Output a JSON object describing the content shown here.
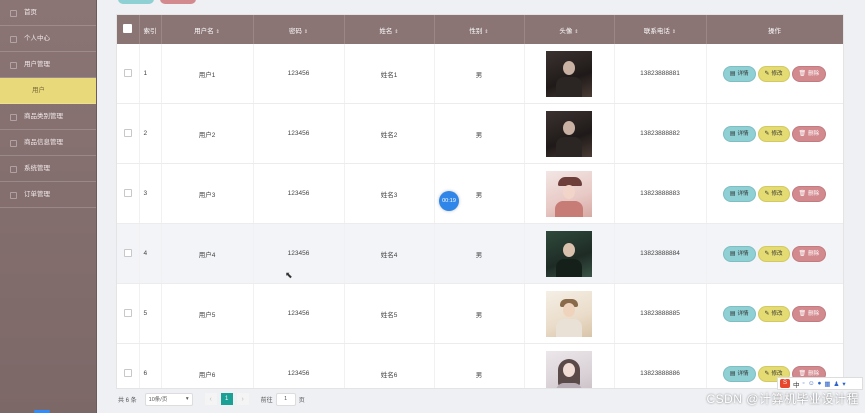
{
  "sidebar": {
    "items": [
      {
        "label": "首页"
      },
      {
        "label": "个人中心"
      },
      {
        "label": "用户管理"
      },
      {
        "label": "用户"
      },
      {
        "label": "商品类别管理"
      },
      {
        "label": "商品信息管理"
      },
      {
        "label": "系统管理"
      },
      {
        "label": "订单管理"
      }
    ]
  },
  "table": {
    "headers": {
      "index": "索引",
      "username": "用户名",
      "password": "密码",
      "name": "姓名",
      "gender": "性别",
      "avatar": "头像",
      "phone": "联系电话",
      "actions": "操作"
    },
    "rows": [
      {
        "index": "1",
        "username": "用户1",
        "password": "123456",
        "name": "姓名1",
        "gender": "男",
        "phone": "13823888881",
        "avatar_style": "dark"
      },
      {
        "index": "2",
        "username": "用户2",
        "password": "123456",
        "name": "姓名2",
        "gender": "男",
        "phone": "13823888882",
        "avatar_style": "dark"
      },
      {
        "index": "3",
        "username": "用户3",
        "password": "123456",
        "name": "姓名3",
        "gender": "男",
        "phone": "13823888883",
        "avatar_style": "pink"
      },
      {
        "index": "4",
        "username": "用户4",
        "password": "123456",
        "name": "姓名4",
        "gender": "男",
        "phone": "13823888884",
        "avatar_style": "green"
      },
      {
        "index": "5",
        "username": "用户5",
        "password": "123456",
        "name": "姓名5",
        "gender": "男",
        "phone": "13823888885",
        "avatar_style": "light"
      },
      {
        "index": "6",
        "username": "用户6",
        "password": "123456",
        "name": "姓名6",
        "gender": "男",
        "phone": "13823888886",
        "avatar_style": "gray"
      }
    ],
    "action_labels": {
      "detail": "详情",
      "edit": "修改",
      "delete": "删除"
    }
  },
  "pagination": {
    "total": "共 6 条",
    "page_size": "10条/页",
    "current": "1",
    "goto_prefix": "前往",
    "goto_value": "1",
    "goto_suffix": "页"
  },
  "overlay": {
    "timer": "00:19",
    "watermark": "CSDN @计算机毕业设计程"
  },
  "ime": {
    "badge": "S",
    "lang": "中"
  },
  "colors": {
    "sidebar": "#8a7474",
    "active_item": "#e8d97a",
    "table_header": "#8a7474",
    "detail_btn": "#8fd0d4",
    "edit_btn": "#e4dc73",
    "delete_btn": "#d38a8f",
    "page_current": "#1aa094"
  }
}
